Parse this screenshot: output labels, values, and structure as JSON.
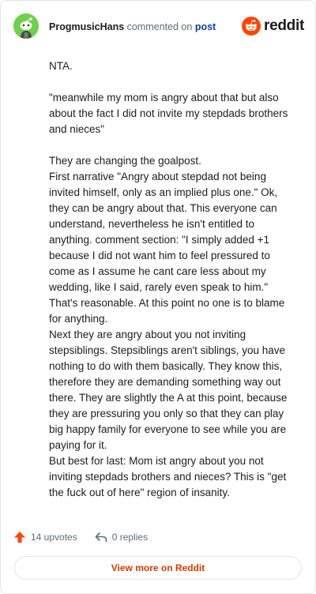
{
  "header": {
    "username": "ProgmusicHans",
    "action_text": " commented on ",
    "post_link": "post",
    "brand_name": "reddit",
    "brand_color": "#ff4500",
    "avatar_color": "#6dd14a"
  },
  "comment": {
    "paragraphs": [
      "NTA.",
      "\"meanwhile my mom is angry about that but also about the fact I did not invite my stepdads brothers and nieces\"",
      "They are changing the goalpost.\nFirst narrative \"Angry about stepdad not being invited himself, only as an implied plus one.\" Ok, they can be angry about that. This everyone can understand, nevertheless he isn't entitled to anything. comment section: \"I simply added +1 because I did not want him to feel pressured to come as I assume he cant care less about my wedding, like I said, rarely even speak to him.\" That's reasonable. At this point no one is to blame for anything.\nNext they are angry about you not inviting stepsiblings. Stepsiblings aren't siblings, you have nothing to do with them basically. They know this, therefore they are demanding something way out there. They are slightly the A at this point, because they are pressuring you only so that they can play big happy family for everyone to see while you are paying for it.\nBut best for last: Mom ist angry about you not inviting stepdads brothers and nieces? This is \"get the fuck out of here\" region of insanity."
    ]
  },
  "footer": {
    "upvotes_label": "14 upvotes",
    "replies_label": "0 replies",
    "upvote_icon_color": "#ff4500"
  },
  "view_more_label": "View more on Reddit"
}
